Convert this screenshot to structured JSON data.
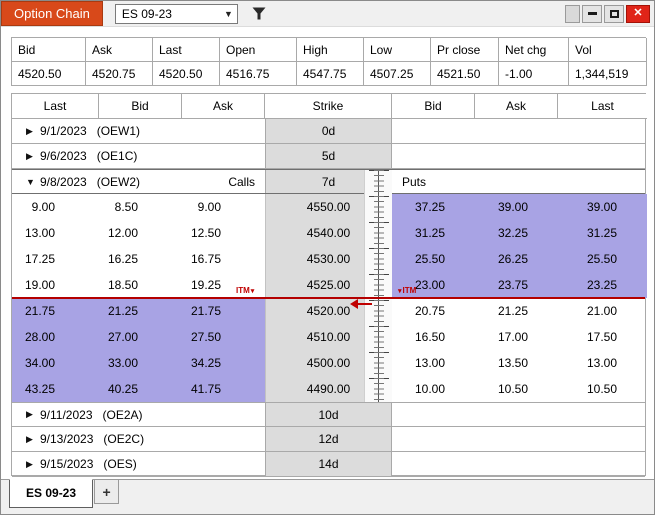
{
  "window": {
    "title": "Option Chain",
    "symbol": "ES 09-23",
    "close_glyph": "✕"
  },
  "colors": {
    "accent_orange": "#d8491a",
    "itm_highlight": "#a8a3e4",
    "price_line_red": "#b40000",
    "strike_bg": "#dcdcdc",
    "close_button_red": "#e02418"
  },
  "quote": {
    "headers": [
      "Bid",
      "Ask",
      "Last",
      "Open",
      "High",
      "Low",
      "Pr close",
      "Net chg",
      "Vol"
    ],
    "values": [
      "4520.50",
      "4520.75",
      "4520.50",
      "4516.75",
      "4547.75",
      "4507.25",
      "4521.50",
      "-1.00",
      "1,344,519"
    ]
  },
  "chain": {
    "columns": [
      "Last",
      "Bid",
      "Ask",
      "Strike",
      "Bid",
      "Ask",
      "Last"
    ],
    "calls_label": "Calls",
    "puts_label": "Puts",
    "itm_label": "ITM",
    "expiries": [
      {
        "date": "9/1/2023",
        "code": "(OEW1)",
        "days": "0d",
        "expanded": false
      },
      {
        "date": "9/6/2023",
        "code": "(OE1C)",
        "days": "5d",
        "expanded": false
      },
      {
        "date": "9/8/2023",
        "code": "(OEW2)",
        "days": "7d",
        "expanded": true
      },
      {
        "date": "9/11/2023",
        "code": "(OE2A)",
        "days": "10d",
        "expanded": false
      },
      {
        "date": "9/13/2023",
        "code": "(OE2C)",
        "days": "12d",
        "expanded": false
      },
      {
        "date": "9/15/2023",
        "code": "(OES)",
        "days": "14d",
        "expanded": false
      }
    ],
    "rows": [
      {
        "call_last": "9.00",
        "call_bid": "8.50",
        "call_ask": "9.00",
        "strike": "4550.00",
        "put_bid": "37.25",
        "put_ask": "39.00",
        "put_last": "39.00",
        "itm_side": "put"
      },
      {
        "call_last": "13.00",
        "call_bid": "12.00",
        "call_ask": "12.50",
        "strike": "4540.00",
        "put_bid": "31.25",
        "put_ask": "32.25",
        "put_last": "31.25",
        "itm_side": "put"
      },
      {
        "call_last": "17.25",
        "call_bid": "16.25",
        "call_ask": "16.75",
        "strike": "4530.00",
        "put_bid": "25.50",
        "put_ask": "26.25",
        "put_last": "25.50",
        "itm_side": "put"
      },
      {
        "call_last": "19.00",
        "call_bid": "18.50",
        "call_ask": "19.25",
        "strike": "4525.00",
        "put_bid": "23.00",
        "put_ask": "23.75",
        "put_last": "23.25",
        "itm_side": "put"
      },
      {
        "call_last": "21.75",
        "call_bid": "21.25",
        "call_ask": "21.75",
        "strike": "4520.00",
        "put_bid": "20.75",
        "put_ask": "21.25",
        "put_last": "21.00",
        "itm_side": "call"
      },
      {
        "call_last": "28.00",
        "call_bid": "27.00",
        "call_ask": "27.50",
        "strike": "4510.00",
        "put_bid": "16.50",
        "put_ask": "17.00",
        "put_last": "17.50",
        "itm_side": "call"
      },
      {
        "call_last": "34.00",
        "call_bid": "33.00",
        "call_ask": "34.25",
        "strike": "4500.00",
        "put_bid": "13.00",
        "put_ask": "13.50",
        "put_last": "13.00",
        "itm_side": "call"
      },
      {
        "call_last": "43.25",
        "call_bid": "40.25",
        "call_ask": "41.75",
        "strike": "4490.00",
        "put_bid": "10.00",
        "put_ask": "10.50",
        "put_last": "10.50",
        "itm_side": "call"
      }
    ]
  },
  "tabs": {
    "active": "ES 09-23",
    "add": "+"
  }
}
